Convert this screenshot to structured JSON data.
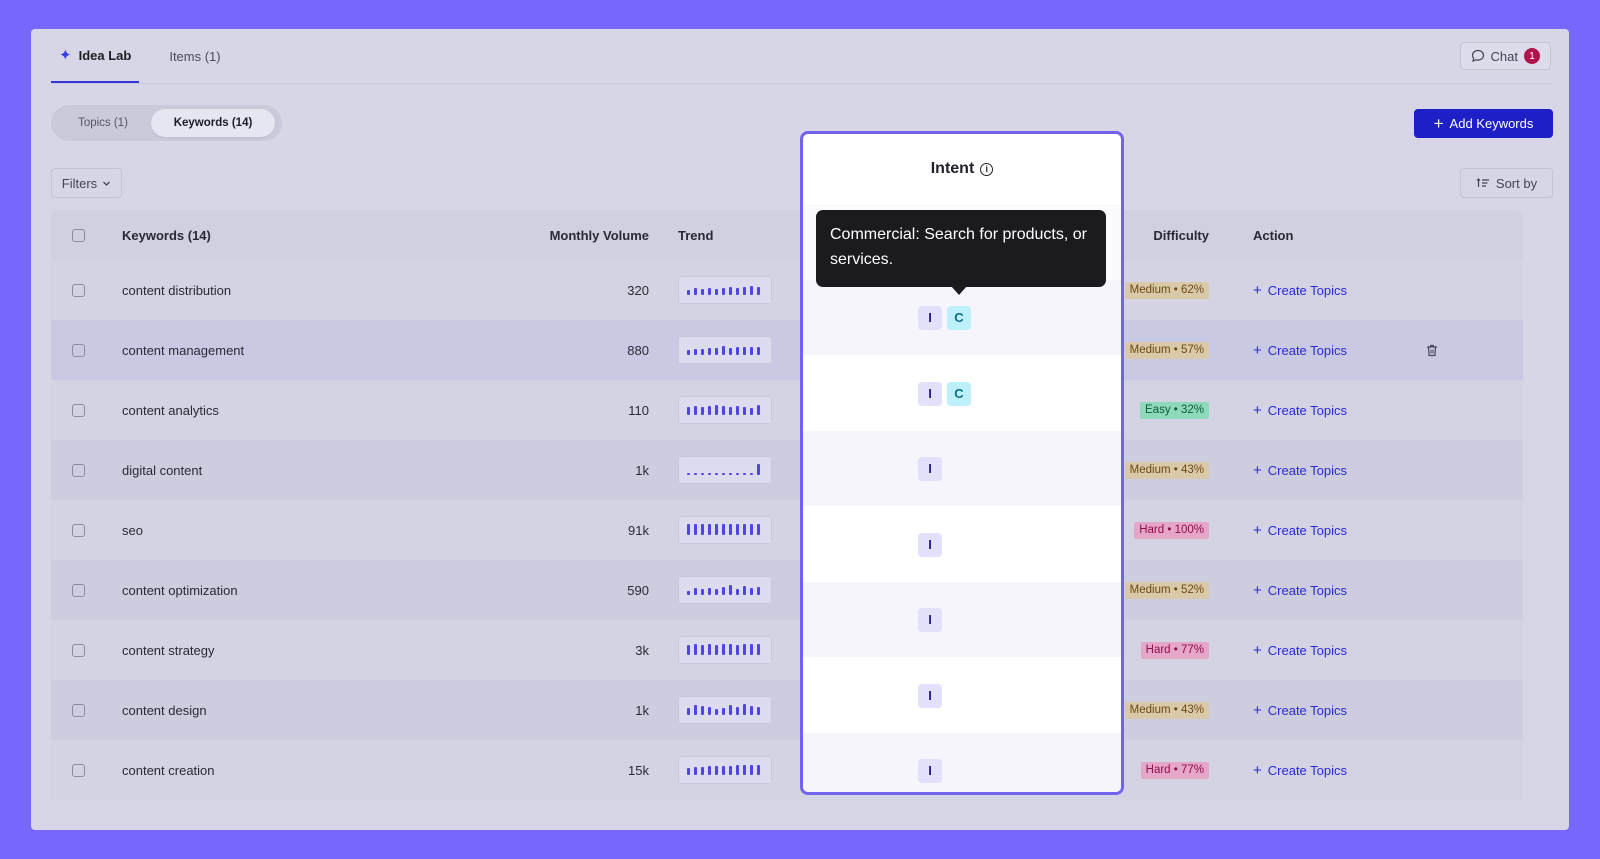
{
  "tabs": [
    {
      "label": "Idea Lab",
      "active": true
    },
    {
      "label": "Items (1)",
      "active": false
    }
  ],
  "chat": {
    "label": "Chat",
    "count": "1"
  },
  "segments": [
    {
      "label": "Topics (1)"
    },
    {
      "label": "Keywords (14)"
    }
  ],
  "add_keywords_label": "Add Keywords",
  "filters_label": "Filters",
  "sort_label": "Sort by",
  "table": {
    "headers": {
      "keywords": "Keywords (14)",
      "volume": "Monthly Volume",
      "trend": "Trend",
      "difficulty": "Difficulty",
      "action": "Action"
    },
    "rows": [
      {
        "keyword": "content distribution",
        "volume": "320",
        "trend": [
          0.45,
          0.6,
          0.55,
          0.65,
          0.5,
          0.6,
          0.7,
          0.6,
          0.75,
          0.8,
          0.7
        ],
        "difficulty": "Medium • 62%",
        "level": "medium",
        "action": "Create Topics"
      },
      {
        "keyword": "content management",
        "volume": "880",
        "trend": [
          0.45,
          0.55,
          0.5,
          0.6,
          0.65,
          0.85,
          0.6,
          0.7,
          0.7,
          0.75,
          0.75
        ],
        "difficulty": "Medium • 57%",
        "level": "medium",
        "action": "Create Topics"
      },
      {
        "keyword": "content analytics",
        "volume": "110",
        "trend": [
          0.7,
          0.85,
          0.7,
          0.8,
          0.9,
          0.8,
          0.75,
          0.85,
          0.75,
          0.6,
          0.9
        ],
        "difficulty": "Easy • 32%",
        "level": "easy",
        "action": "Create Topics"
      },
      {
        "keyword": "digital content",
        "volume": "1k",
        "trend": [
          0.12,
          0.12,
          0.12,
          0.12,
          0.12,
          0.12,
          0.12,
          0.12,
          0.12,
          0.12,
          1.0
        ],
        "difficulty": "Medium • 43%",
        "level": "medium",
        "action": "Create Topics"
      },
      {
        "keyword": "seo",
        "volume": "91k",
        "trend": [
          1,
          1,
          1,
          1,
          1,
          1,
          1,
          1,
          1,
          1,
          1
        ],
        "difficulty": "Hard • 100%",
        "level": "hard",
        "action": "Create Topics"
      },
      {
        "keyword": "content optimization",
        "volume": "590",
        "trend": [
          0.4,
          0.6,
          0.5,
          0.65,
          0.5,
          0.7,
          0.9,
          0.55,
          0.8,
          0.65,
          0.7
        ],
        "difficulty": "Medium • 52%",
        "level": "medium",
        "action": "Create Topics"
      },
      {
        "keyword": "content strategy",
        "volume": "3k",
        "trend": [
          0.9,
          1,
          0.95,
          1,
          0.95,
          1,
          1,
          0.95,
          1,
          1,
          1
        ],
        "difficulty": "Hard • 77%",
        "level": "hard",
        "action": "Create Topics"
      },
      {
        "keyword": "content design",
        "volume": "1k",
        "trend": [
          0.6,
          0.9,
          0.8,
          0.75,
          0.55,
          0.65,
          0.95,
          0.75,
          1,
          0.85,
          0.7
        ],
        "difficulty": "Medium • 43%",
        "level": "medium",
        "action": "Create Topics"
      },
      {
        "keyword": "content creation",
        "volume": "15k",
        "trend": [
          0.6,
          0.7,
          0.75,
          0.8,
          0.8,
          0.85,
          0.85,
          0.9,
          0.9,
          0.9,
          0.95
        ],
        "difficulty": "Hard • 77%",
        "level": "hard",
        "action": "Create Topics"
      }
    ]
  },
  "intent_popup": {
    "title": "Intent",
    "tooltip": "Commercial: Search for products, or services.",
    "rows": [
      [
        "I",
        "C"
      ],
      [
        "I",
        "C"
      ],
      [
        "I"
      ],
      [
        "I"
      ],
      [
        "I"
      ],
      [
        "I"
      ],
      [
        "I"
      ]
    ]
  },
  "colors": {
    "accent": "#1f1fc8",
    "backdrop": "#7768fb",
    "trend_bar": "#4f44e5"
  }
}
